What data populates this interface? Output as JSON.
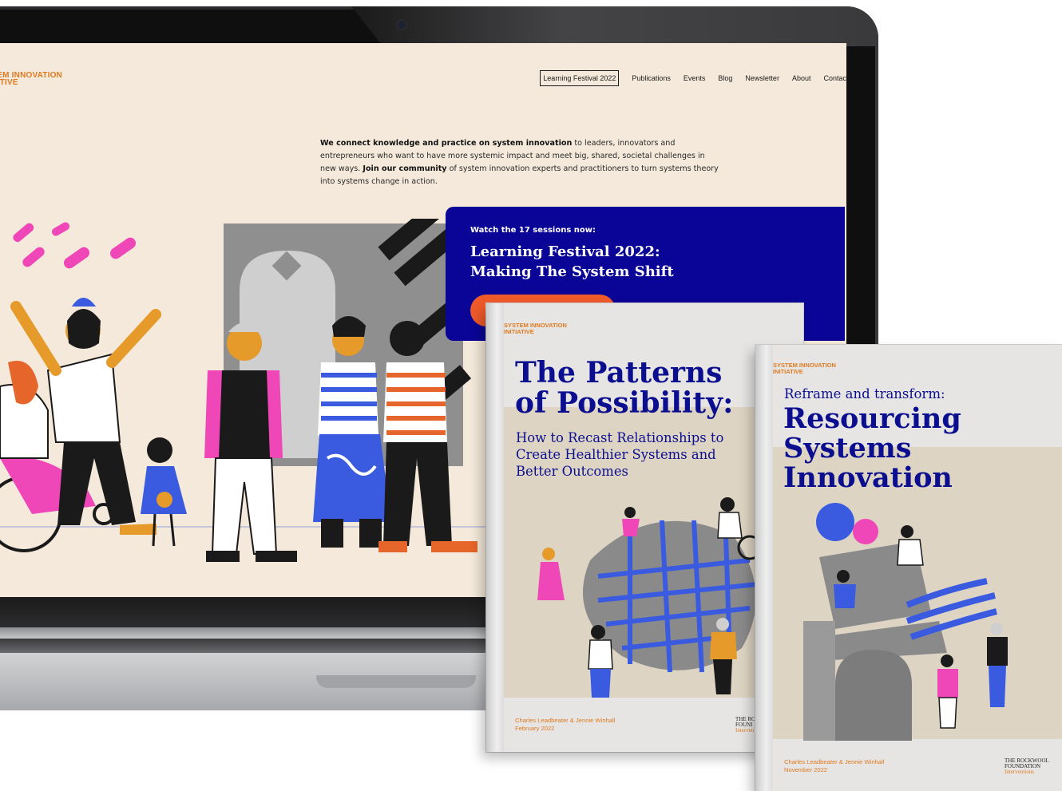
{
  "site": {
    "logo_line1": "TEM INNOVATION",
    "logo_line2": "IATIVE",
    "nav": {
      "items": [
        "Learning Festival 2022",
        "Publications",
        "Events",
        "Blog",
        "Newsletter",
        "About",
        "Contac"
      ]
    },
    "intro": {
      "bold1": "We connect knowledge and practice on system innovation",
      "text1": " to leaders, innovators and entrepreneurs who want to have more systemic impact and meet big, shared, societal challenges in new ways. ",
      "bold2": "Join our community",
      "text2": " of system innovation experts and practitioners to turn systems theory into systems change in action."
    },
    "feature": {
      "kicker": "Watch the 17 sessions now:",
      "headline_line1": "Learning Festival 2022:",
      "headline_line2": "Making The System Shift",
      "accent_color": "#0a0596",
      "cta_color": "#ef5a2a"
    }
  },
  "reports": [
    {
      "logo_line1": "SYSTEM INNOVATION",
      "logo_line2": "INITIATIVE",
      "title_line1": "The Patterns",
      "title_line2": "of Possibility:",
      "subtitle": "How to Recast Relationships to Create Healthier Systems and Better Outcomes",
      "authors": "Charles Leadbeater & Jennie Winhall",
      "date": "February 2022",
      "foundation_line1": "THE RO",
      "foundation_line2": "FOUNI",
      "foundation_line3": "Interven"
    },
    {
      "logo_line1": "SYSTEM INNOVATION",
      "logo_line2": "INITIATIVE",
      "kicker": "Reframe and transform:",
      "title_line1": "Resourcing",
      "title_line2": "Systems",
      "title_line3": "Innovation",
      "authors": "Charles Leadbeater & Jennie Winhall",
      "date": "November 2022",
      "foundation_line1": "THE ROCKWOOL",
      "foundation_line2": "FOUNDATION",
      "foundation_line3": "Interventions"
    }
  ],
  "colors": {
    "brand_orange": "#e07a1f",
    "report_navy": "#0b0f8f",
    "screen_bg": "#f4e9da"
  }
}
